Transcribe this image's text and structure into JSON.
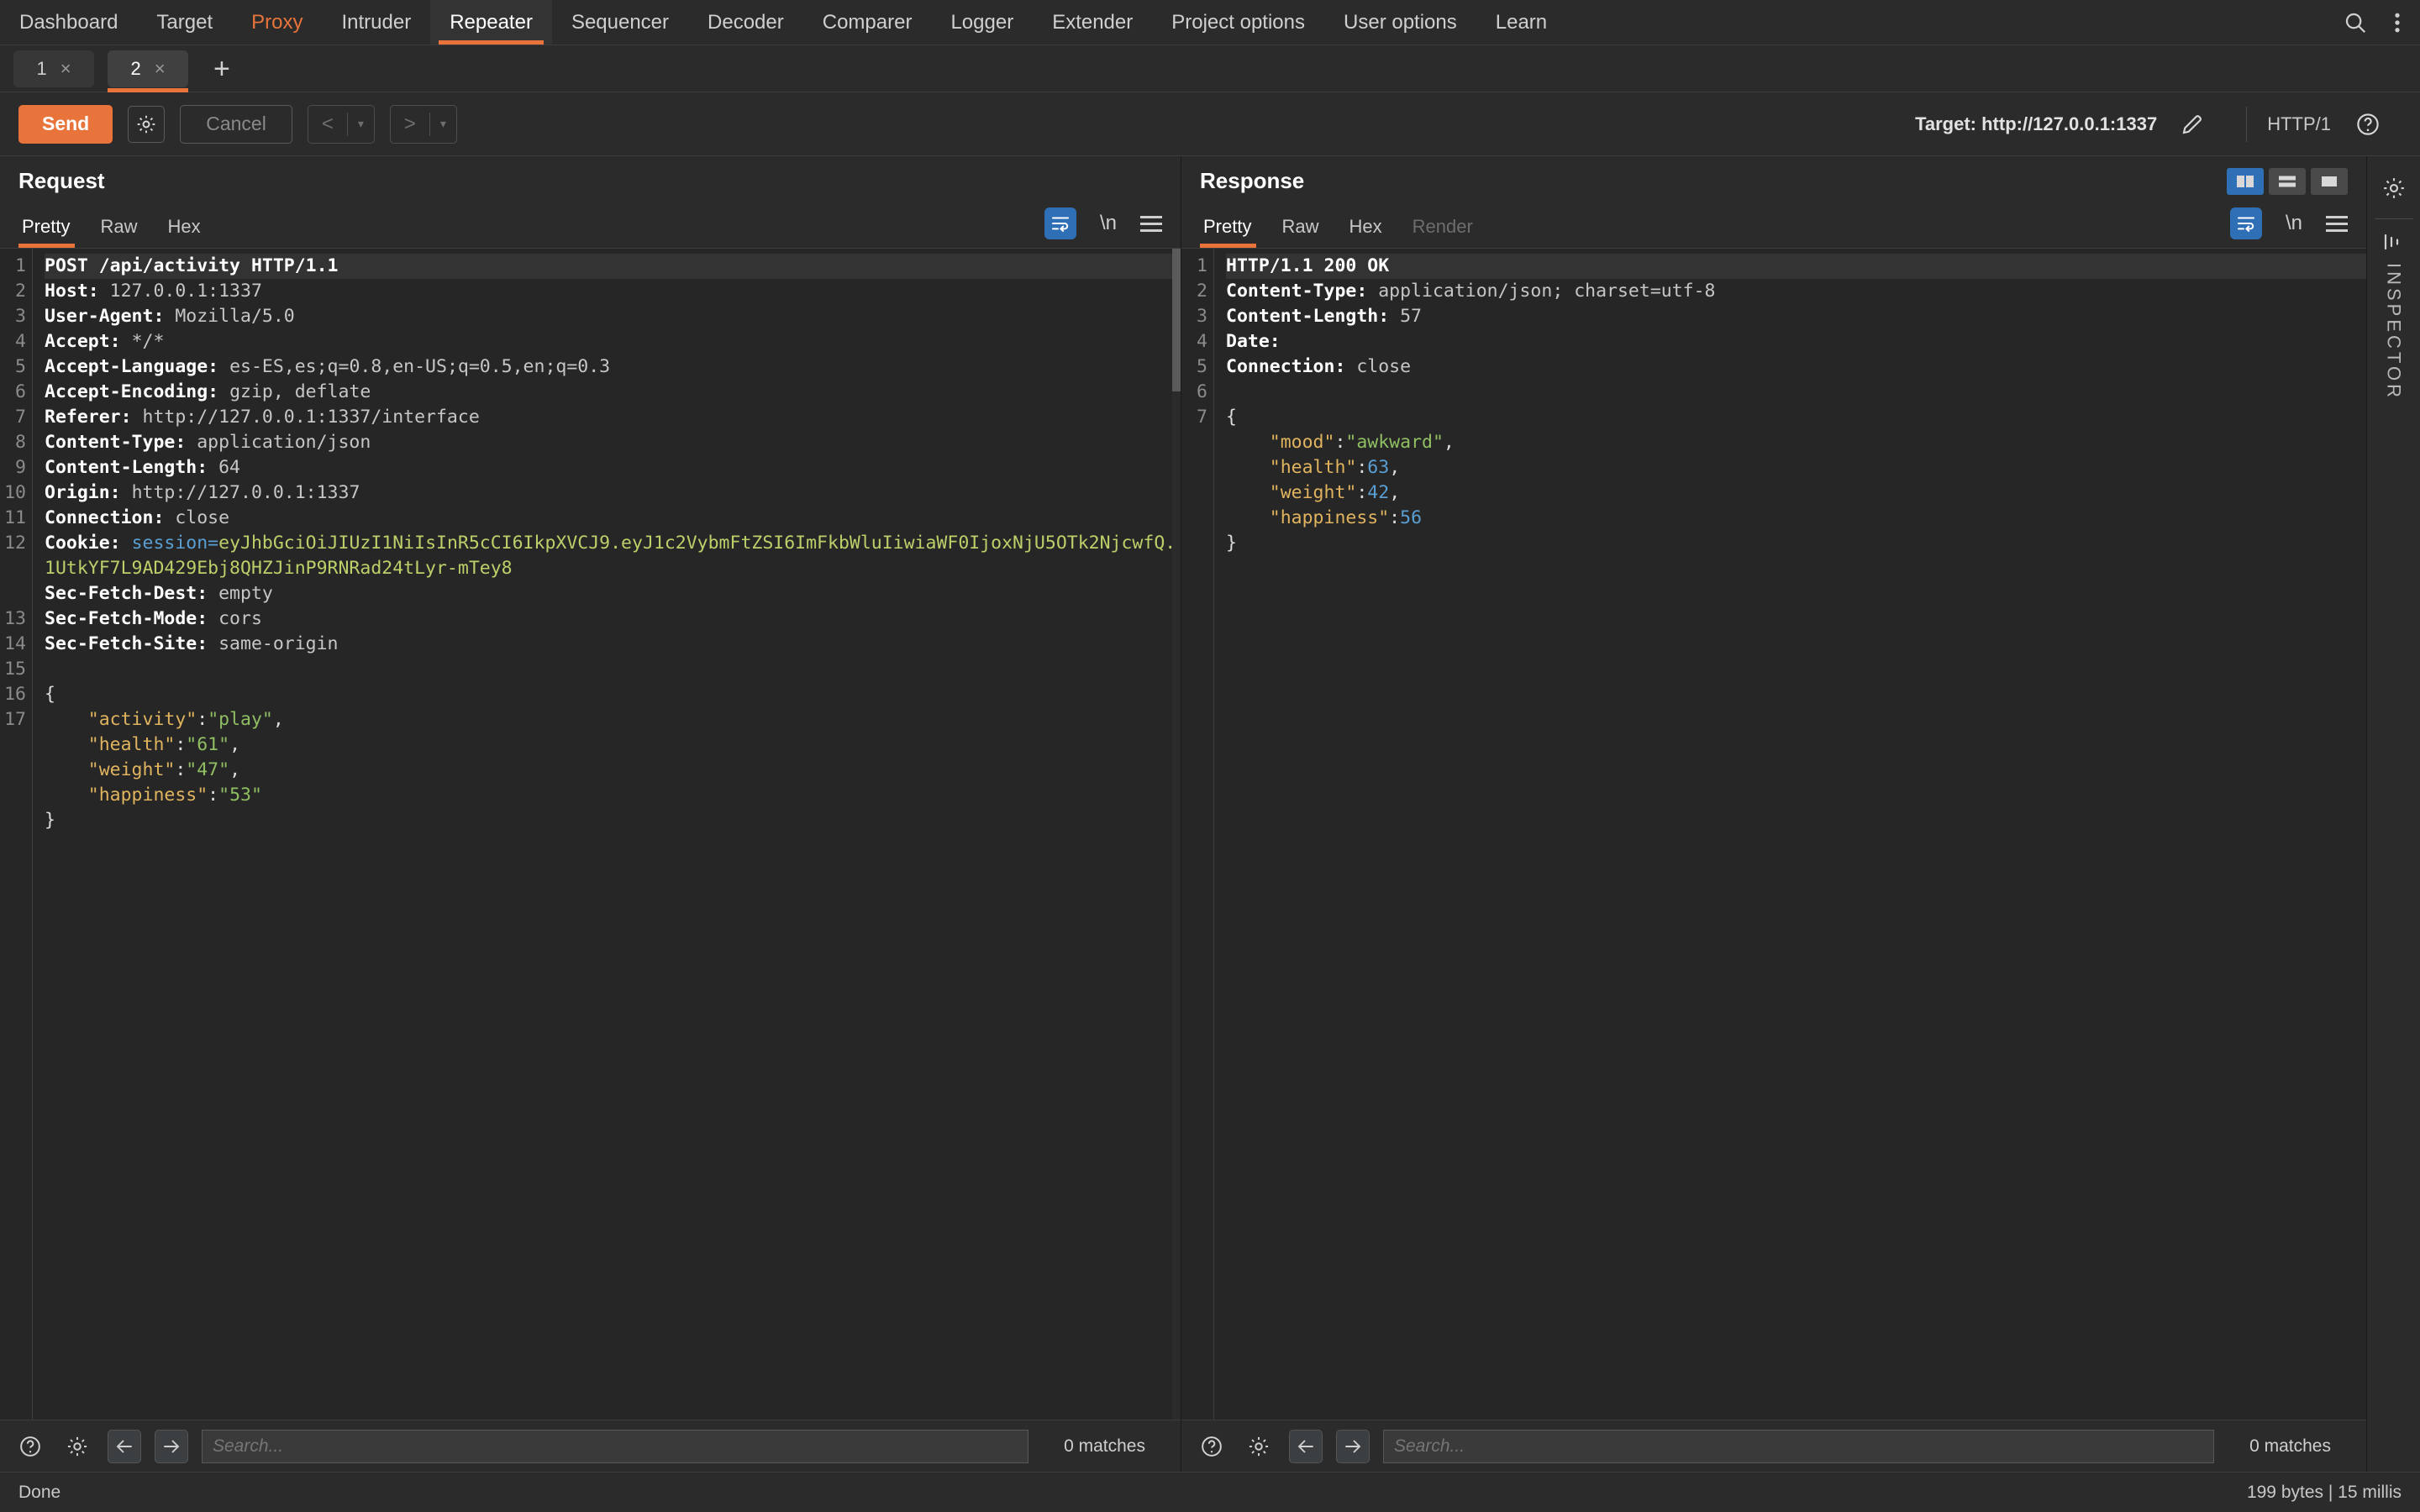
{
  "menubar": {
    "items": [
      {
        "label": "Dashboard",
        "state": "normal"
      },
      {
        "label": "Target",
        "state": "normal"
      },
      {
        "label": "Proxy",
        "state": "highlight"
      },
      {
        "label": "Intruder",
        "state": "normal"
      },
      {
        "label": "Repeater",
        "state": "active"
      },
      {
        "label": "Sequencer",
        "state": "normal"
      },
      {
        "label": "Decoder",
        "state": "normal"
      },
      {
        "label": "Comparer",
        "state": "normal"
      },
      {
        "label": "Logger",
        "state": "normal"
      },
      {
        "label": "Extender",
        "state": "normal"
      },
      {
        "label": "Project options",
        "state": "normal"
      },
      {
        "label": "User options",
        "state": "normal"
      },
      {
        "label": "Learn",
        "state": "normal"
      }
    ],
    "search_icon": "search-icon",
    "overflow_icon": "kebab-menu-icon",
    "accent_color": "#e8743b"
  },
  "tabstrip": {
    "tabs": [
      {
        "label": "1",
        "close": "×",
        "active": false
      },
      {
        "label": "2",
        "close": "×",
        "active": true
      }
    ],
    "add_label": "+"
  },
  "actionbar": {
    "send_label": "Send",
    "settings_icon": "gear-icon",
    "cancel_label": "Cancel",
    "prev_label": "<",
    "prev_caret": "▾",
    "next_label": ">",
    "next_caret": "▾",
    "target_label": "Target: http://127.0.0.1:1337",
    "edit_icon": "pencil-icon",
    "http_version": "HTTP/1",
    "help_icon": "help-circle-icon"
  },
  "layout_toggle": {
    "options": [
      "side-by-side-layout",
      "stacked-layout",
      "single-pane-layout"
    ],
    "active_index": 0,
    "active_color": "#2f6fb5"
  },
  "request": {
    "title": "Request",
    "tabs": [
      {
        "label": "Pretty",
        "active": true,
        "disabled": false
      },
      {
        "label": "Raw",
        "active": false,
        "disabled": false
      },
      {
        "label": "Hex",
        "active": false,
        "disabled": false
      }
    ],
    "icons": [
      "word-wrap-icon",
      "newline-icon",
      "hamburger-menu-icon"
    ],
    "newline_label": "\\n",
    "lines": [
      {
        "num": "1",
        "selected": true,
        "parts": [
          {
            "t": "POST /api/activity HTTP/1.1",
            "c": "resp-first"
          }
        ]
      },
      {
        "num": "2",
        "parts": [
          {
            "t": "Host: ",
            "c": "hdr-name"
          },
          {
            "t": "127.0.0.1:1337",
            "c": "hdr-val"
          }
        ]
      },
      {
        "num": "3",
        "parts": [
          {
            "t": "User-Agent: ",
            "c": "hdr-name"
          },
          {
            "t": "Mozilla/5.0",
            "c": "hdr-val"
          }
        ]
      },
      {
        "num": "4",
        "parts": [
          {
            "t": "Accept: ",
            "c": "hdr-name"
          },
          {
            "t": "*/*",
            "c": "hdr-val"
          }
        ]
      },
      {
        "num": "5",
        "parts": [
          {
            "t": "Accept-Language: ",
            "c": "hdr-name"
          },
          {
            "t": "es-ES,es;q=0.8,en-US;q=0.5,en;q=0.3",
            "c": "hdr-val"
          }
        ]
      },
      {
        "num": "6",
        "parts": [
          {
            "t": "Accept-Encoding: ",
            "c": "hdr-name"
          },
          {
            "t": "gzip, deflate",
            "c": "hdr-val"
          }
        ]
      },
      {
        "num": "7",
        "parts": [
          {
            "t": "Referer: ",
            "c": "hdr-name"
          },
          {
            "t": "http://127.0.0.1:1337/interface",
            "c": "hdr-val"
          }
        ]
      },
      {
        "num": "8",
        "parts": [
          {
            "t": "Content-Type: ",
            "c": "hdr-name"
          },
          {
            "t": "application/json",
            "c": "hdr-val"
          }
        ]
      },
      {
        "num": "9",
        "parts": [
          {
            "t": "Content-Length: ",
            "c": "hdr-name"
          },
          {
            "t": "64",
            "c": "hdr-val"
          }
        ]
      },
      {
        "num": "10",
        "parts": [
          {
            "t": "Origin: ",
            "c": "hdr-name"
          },
          {
            "t": "http://127.0.0.1:1337",
            "c": "hdr-val"
          }
        ]
      },
      {
        "num": "11",
        "parts": [
          {
            "t": "Connection: ",
            "c": "hdr-name"
          },
          {
            "t": "close",
            "c": "hdr-val"
          }
        ]
      },
      {
        "num": "12",
        "wrap": true,
        "parts": [
          {
            "t": "Cookie: ",
            "c": "hdr-name"
          },
          {
            "t": "session=",
            "c": "n"
          },
          {
            "t": "eyJhbGciOiJIUzI1NiIsInR5cCI6IkpXVCJ9.eyJ1c2VybmFtZSI6ImFkbWluIiwiaWF0IjoxNjU5OTk2NjcwfQ.1UtkYF7L9AD429Ebj8QHZJinP9RNRad24tLyr-mTey8",
            "c": "jwt"
          }
        ]
      },
      {
        "num": "13",
        "parts": [
          {
            "t": "Sec-Fetch-Dest: ",
            "c": "hdr-name"
          },
          {
            "t": "empty",
            "c": "hdr-val"
          }
        ]
      },
      {
        "num": "14",
        "parts": [
          {
            "t": "Sec-Fetch-Mode: ",
            "c": "hdr-name"
          },
          {
            "t": "cors",
            "c": "hdr-val"
          }
        ]
      },
      {
        "num": "15",
        "parts": [
          {
            "t": "Sec-Fetch-Site: ",
            "c": "hdr-name"
          },
          {
            "t": "same-origin",
            "c": "hdr-val"
          }
        ]
      },
      {
        "num": "16",
        "parts": [
          {
            "t": "",
            "c": "p"
          }
        ]
      },
      {
        "num": "17",
        "parts": [
          {
            "t": "{",
            "c": "p"
          }
        ]
      },
      {
        "num": "",
        "parts": [
          {
            "t": "    ",
            "c": "p"
          },
          {
            "t": "\"activity\"",
            "c": "k"
          },
          {
            "t": ":",
            "c": "p"
          },
          {
            "t": "\"play\"",
            "c": "s"
          },
          {
            "t": ",",
            "c": "p"
          }
        ]
      },
      {
        "num": "",
        "parts": [
          {
            "t": "    ",
            "c": "p"
          },
          {
            "t": "\"health\"",
            "c": "k"
          },
          {
            "t": ":",
            "c": "p"
          },
          {
            "t": "\"61\"",
            "c": "s"
          },
          {
            "t": ",",
            "c": "p"
          }
        ]
      },
      {
        "num": "",
        "parts": [
          {
            "t": "    ",
            "c": "p"
          },
          {
            "t": "\"weight\"",
            "c": "k"
          },
          {
            "t": ":",
            "c": "p"
          },
          {
            "t": "\"47\"",
            "c": "s"
          },
          {
            "t": ",",
            "c": "p"
          }
        ]
      },
      {
        "num": "",
        "parts": [
          {
            "t": "    ",
            "c": "p"
          },
          {
            "t": "\"happiness\"",
            "c": "k"
          },
          {
            "t": ":",
            "c": "p"
          },
          {
            "t": "\"53\"",
            "c": "s"
          }
        ]
      },
      {
        "num": "",
        "parts": [
          {
            "t": "}",
            "c": "p"
          }
        ]
      }
    ],
    "search": {
      "help_icon": "help-circle-icon",
      "settings_icon": "gear-icon",
      "back_icon": "arrow-left-icon",
      "forward_icon": "arrow-right-icon",
      "placeholder": "Search...",
      "value": "",
      "matches": "0 matches"
    }
  },
  "response": {
    "title": "Response",
    "tabs": [
      {
        "label": "Pretty",
        "active": true,
        "disabled": false
      },
      {
        "label": "Raw",
        "active": false,
        "disabled": false
      },
      {
        "label": "Hex",
        "active": false,
        "disabled": false
      },
      {
        "label": "Render",
        "active": false,
        "disabled": true
      }
    ],
    "icons": [
      "word-wrap-icon",
      "newline-icon",
      "hamburger-menu-icon"
    ],
    "newline_label": "\\n",
    "lines": [
      {
        "num": "1",
        "selected": true,
        "parts": [
          {
            "t": "HTTP/1.1 200 OK",
            "c": "resp-first"
          }
        ]
      },
      {
        "num": "2",
        "parts": [
          {
            "t": "Content-Type: ",
            "c": "hdr-name"
          },
          {
            "t": "application/json; charset=utf-8",
            "c": "hdr-val"
          }
        ]
      },
      {
        "num": "3",
        "parts": [
          {
            "t": "Content-Length: ",
            "c": "hdr-name"
          },
          {
            "t": "57",
            "c": "hdr-val"
          }
        ]
      },
      {
        "num": "4",
        "parts": [
          {
            "t": "Date: ",
            "c": "hdr-name"
          }
        ]
      },
      {
        "num": "5",
        "parts": [
          {
            "t": "Connection: ",
            "c": "hdr-name"
          },
          {
            "t": "close",
            "c": "hdr-val"
          }
        ]
      },
      {
        "num": "6",
        "parts": [
          {
            "t": "",
            "c": "p"
          }
        ]
      },
      {
        "num": "7",
        "parts": [
          {
            "t": "{",
            "c": "p"
          }
        ]
      },
      {
        "num": "",
        "parts": [
          {
            "t": "    ",
            "c": "p"
          },
          {
            "t": "\"mood\"",
            "c": "k"
          },
          {
            "t": ":",
            "c": "p"
          },
          {
            "t": "\"awkward\"",
            "c": "s"
          },
          {
            "t": ",",
            "c": "p"
          }
        ]
      },
      {
        "num": "",
        "parts": [
          {
            "t": "    ",
            "c": "p"
          },
          {
            "t": "\"health\"",
            "c": "k"
          },
          {
            "t": ":",
            "c": "p"
          },
          {
            "t": "63",
            "c": "n"
          },
          {
            "t": ",",
            "c": "p"
          }
        ]
      },
      {
        "num": "",
        "parts": [
          {
            "t": "    ",
            "c": "p"
          },
          {
            "t": "\"weight\"",
            "c": "k"
          },
          {
            "t": ":",
            "c": "p"
          },
          {
            "t": "42",
            "c": "n"
          },
          {
            "t": ",",
            "c": "p"
          }
        ]
      },
      {
        "num": "",
        "parts": [
          {
            "t": "    ",
            "c": "p"
          },
          {
            "t": "\"happiness\"",
            "c": "k"
          },
          {
            "t": ":",
            "c": "p"
          },
          {
            "t": "56",
            "c": "n"
          }
        ]
      },
      {
        "num": "",
        "parts": [
          {
            "t": "}",
            "c": "p"
          }
        ]
      }
    ],
    "search": {
      "help_icon": "help-circle-icon",
      "settings_icon": "gear-icon",
      "back_icon": "arrow-left-icon",
      "forward_icon": "arrow-right-icon",
      "placeholder": "Search...",
      "value": "",
      "matches": "0 matches"
    }
  },
  "rail": {
    "settings_icon": "gear-icon",
    "collapse_icon": "collapse-panel-icon",
    "label": "INSPECTOR"
  },
  "statusbar": {
    "left": "Done",
    "right": "199 bytes | 15 millis"
  }
}
